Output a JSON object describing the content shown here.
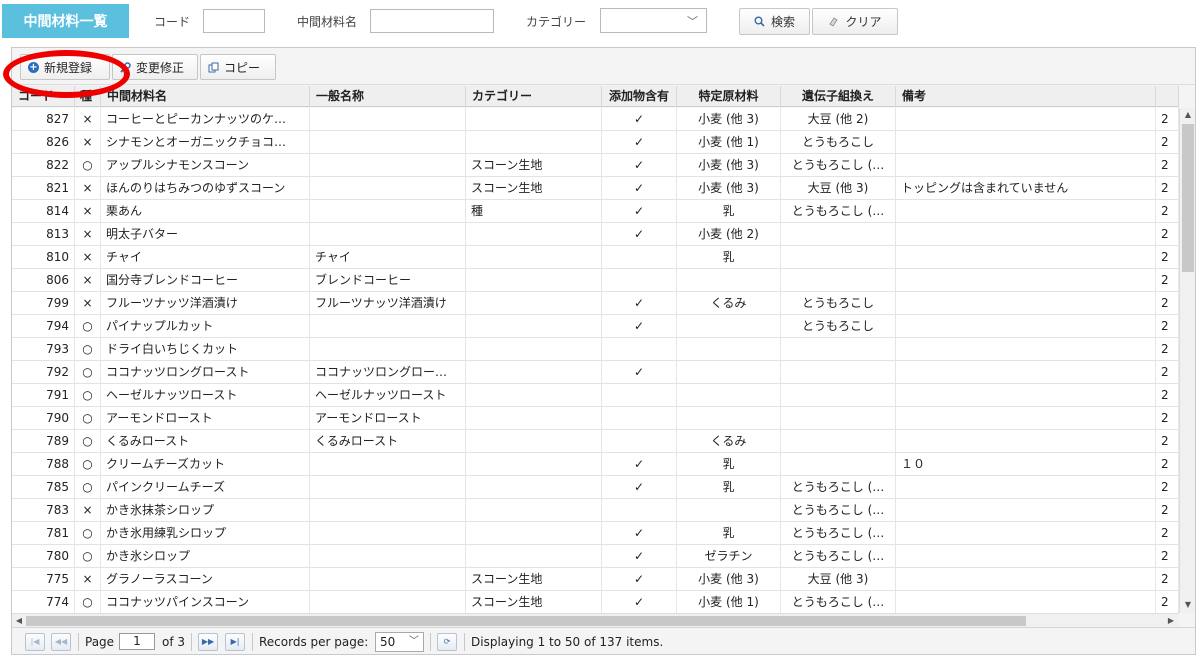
{
  "header": {
    "title": "中間材料一覧",
    "code_label": "コード",
    "code_value": "",
    "name_label": "中間材料名",
    "name_value": "",
    "category_label": "カテゴリー",
    "category_value": "",
    "search_label": "検索",
    "clear_label": "クリア"
  },
  "toolbar": {
    "new_label": "新規登録",
    "edit_label": "変更修正",
    "copy_label": "コピー"
  },
  "columns": [
    "コード",
    "種",
    "中間材料名",
    "一般名称",
    "カテゴリー",
    "添加物含有",
    "特定原材料",
    "遺伝子組換え",
    "備考"
  ],
  "rows": [
    {
      "code": "827",
      "type": "×",
      "name": "コーヒーとピーカンナッツのケ…",
      "general": "",
      "category": "",
      "additive": "✓",
      "allergen": "小麦 (他 3)",
      "gmo": "大豆 (他 2)",
      "note": "",
      "extra": "2"
    },
    {
      "code": "826",
      "type": "×",
      "name": "シナモンとオーガニックチョコ…",
      "general": "",
      "category": "",
      "additive": "✓",
      "allergen": "小麦 (他 1)",
      "gmo": "とうもろこし",
      "note": "",
      "extra": "2"
    },
    {
      "code": "822",
      "type": "○",
      "name": "アップルシナモンスコーン",
      "general": "",
      "category": "スコーン生地",
      "additive": "✓",
      "allergen": "小麦 (他 3)",
      "gmo": "とうもろこし (…",
      "note": "",
      "extra": "2"
    },
    {
      "code": "821",
      "type": "×",
      "name": "ほんのりはちみつのゆずスコーン",
      "general": "",
      "category": "スコーン生地",
      "additive": "✓",
      "allergen": "小麦 (他 3)",
      "gmo": "大豆 (他 3)",
      "note": "トッピングは含まれていません",
      "extra": "2"
    },
    {
      "code": "814",
      "type": "×",
      "name": "栗あん",
      "general": "",
      "category": "種",
      "additive": "✓",
      "allergen": "乳",
      "gmo": "とうもろこし (…",
      "note": "",
      "extra": "2"
    },
    {
      "code": "813",
      "type": "×",
      "name": "明太子バター",
      "general": "",
      "category": "",
      "additive": "✓",
      "allergen": "小麦 (他 2)",
      "gmo": "",
      "note": "",
      "extra": "2"
    },
    {
      "code": "810",
      "type": "×",
      "name": "チャイ",
      "general": "チャイ",
      "category": "",
      "additive": "",
      "allergen": "乳",
      "gmo": "",
      "note": "",
      "extra": "2"
    },
    {
      "code": "806",
      "type": "×",
      "name": "国分寺ブレンドコーヒー",
      "general": "ブレンドコーヒー",
      "category": "",
      "additive": "",
      "allergen": "",
      "gmo": "",
      "note": "",
      "extra": "2"
    },
    {
      "code": "799",
      "type": "×",
      "name": "フルーツナッツ洋酒漬け",
      "general": "フルーツナッツ洋酒漬け",
      "category": "",
      "additive": "✓",
      "allergen": "くるみ",
      "gmo": "とうもろこし",
      "note": "",
      "extra": "2"
    },
    {
      "code": "794",
      "type": "○",
      "name": "パイナップルカット",
      "general": "",
      "category": "",
      "additive": "✓",
      "allergen": "",
      "gmo": "とうもろこし",
      "note": "",
      "extra": "2"
    },
    {
      "code": "793",
      "type": "○",
      "name": "ドライ白いちじくカット",
      "general": "",
      "category": "",
      "additive": "",
      "allergen": "",
      "gmo": "",
      "note": "",
      "extra": "2"
    },
    {
      "code": "792",
      "type": "○",
      "name": "ココナッツロングロースト",
      "general": "ココナッツロングロー…",
      "category": "",
      "additive": "✓",
      "allergen": "",
      "gmo": "",
      "note": "",
      "extra": "2"
    },
    {
      "code": "791",
      "type": "○",
      "name": "ヘーゼルナッツロースト",
      "general": "ヘーゼルナッツロースト",
      "category": "",
      "additive": "",
      "allergen": "",
      "gmo": "",
      "note": "",
      "extra": "2"
    },
    {
      "code": "790",
      "type": "○",
      "name": "アーモンドロースト",
      "general": "アーモンドロースト",
      "category": "",
      "additive": "",
      "allergen": "",
      "gmo": "",
      "note": "",
      "extra": "2"
    },
    {
      "code": "789",
      "type": "○",
      "name": "くるみロースト",
      "general": "くるみロースト",
      "category": "",
      "additive": "",
      "allergen": "くるみ",
      "gmo": "",
      "note": "",
      "extra": "2"
    },
    {
      "code": "788",
      "type": "○",
      "name": "クリームチーズカット",
      "general": "",
      "category": "",
      "additive": "✓",
      "allergen": "乳",
      "gmo": "",
      "note": "１０",
      "extra": "2"
    },
    {
      "code": "785",
      "type": "○",
      "name": "パインクリームチーズ",
      "general": "",
      "category": "",
      "additive": "✓",
      "allergen": "乳",
      "gmo": "とうもろこし (…",
      "note": "",
      "extra": "2"
    },
    {
      "code": "783",
      "type": "×",
      "name": "かき氷抹茶シロップ",
      "general": "",
      "category": "",
      "additive": "",
      "allergen": "",
      "gmo": "とうもろこし (…",
      "note": "",
      "extra": "2"
    },
    {
      "code": "781",
      "type": "○",
      "name": "かき氷用練乳シロップ",
      "general": "",
      "category": "",
      "additive": "✓",
      "allergen": "乳",
      "gmo": "とうもろこし (…",
      "note": "",
      "extra": "2"
    },
    {
      "code": "780",
      "type": "○",
      "name": "かき氷シロップ",
      "general": "",
      "category": "",
      "additive": "✓",
      "allergen": "ゼラチン",
      "gmo": "とうもろこし (…",
      "note": "",
      "extra": "2"
    },
    {
      "code": "775",
      "type": "×",
      "name": "グラノーラスコーン",
      "general": "",
      "category": "スコーン生地",
      "additive": "✓",
      "allergen": "小麦 (他 3)",
      "gmo": "大豆 (他 3)",
      "note": "",
      "extra": "2"
    },
    {
      "code": "774",
      "type": "○",
      "name": "ココナッツパインスコーン",
      "general": "",
      "category": "スコーン生地",
      "additive": "✓",
      "allergen": "小麦 (他 1)",
      "gmo": "とうもろこし (…",
      "note": "",
      "extra": "2"
    }
  ],
  "pager": {
    "page_label": "Page",
    "page_value": "1",
    "of_label": "of 3",
    "rpp_label": "Records per page:",
    "rpp_value": "50",
    "display_text": "Displaying 1 to 50 of 137 items."
  }
}
